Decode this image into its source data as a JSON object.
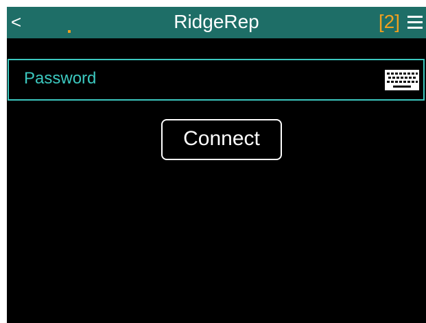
{
  "header": {
    "back_label": "<",
    "title": "RidgeRep",
    "badge": "[2]",
    "menu_icon": "hamburger-menu-icon"
  },
  "password": {
    "placeholder": "Password",
    "value": "",
    "keyboard_icon": "keyboard-icon"
  },
  "connect": {
    "label": "Connect"
  },
  "colors": {
    "header_bg": "#1e6e67",
    "accent": "#3cc9c0",
    "badge": "#f0a020",
    "screen_bg": "#000000"
  }
}
